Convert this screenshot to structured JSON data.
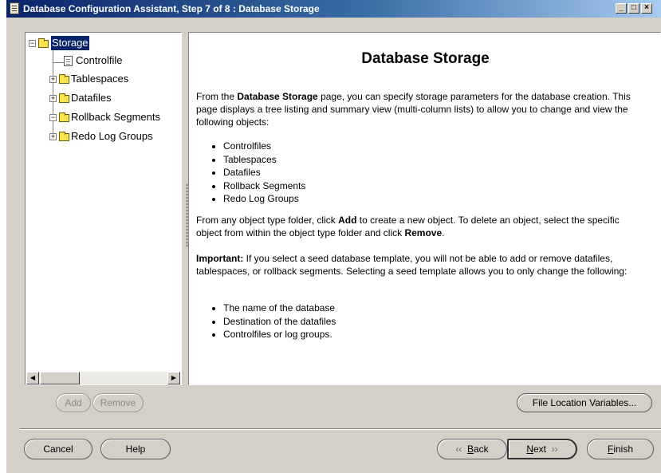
{
  "window": {
    "title": "Database Configuration Assistant, Step 7 of 8 : Database Storage",
    "icon": "app-document-icon",
    "minimize": "_",
    "maximize": "□",
    "close": "×"
  },
  "tree": {
    "items": [
      {
        "label": "Storage",
        "selected": true,
        "icon": "folder-open-icon"
      },
      {
        "label": "Controlfile",
        "icon": "file-icon"
      },
      {
        "label": "Tablespaces",
        "icon": "folder-icon"
      },
      {
        "label": "Datafiles",
        "icon": "folder-icon"
      },
      {
        "label": "Rollback Segments",
        "icon": "folder-open-icon"
      },
      {
        "label": "Redo Log Groups",
        "icon": "folder-icon"
      }
    ]
  },
  "help": {
    "heading": "Database Storage",
    "p1_a": "From the ",
    "p1_b": "Database Storage",
    "p1_c": " page, you can specify storage parameters for the database creation. This page displays a tree listing and summary view (multi-column lists) to allow you to change and view the following objects:",
    "list1": [
      "Controlfiles",
      "Tablespaces",
      "Datafiles",
      "Rollback Segments",
      "Redo Log Groups"
    ],
    "p2_a": "From any object type folder, click ",
    "p2_b": "Add",
    "p2_c": " to create a new object. To delete an object, select the specific object from within the object type folder and click ",
    "p2_d": "Remove",
    "p2_e": ".",
    "p3_a": "Important:",
    "p3_b": " If you select a seed database template, you will not be able to add or remove datafiles, tablespaces, or rollback segments. Selecting a seed template allows you to only change the following:",
    "list2": [
      "The name of the database",
      "Destination of the datafiles",
      "Controlfiles or log groups."
    ]
  },
  "buttons": {
    "add": "Add",
    "remove": "Remove",
    "file_location": "File Location Variables...",
    "cancel": "Cancel",
    "help": "Help",
    "back_mnemonic": "B",
    "back_rest": "ack",
    "next_mnemonic": "N",
    "next_rest": "ext",
    "finish_mnemonic": "F",
    "finish_rest": "inish",
    "back_icon": "chevron-left-icon",
    "next_icon": "chevron-right-icon"
  },
  "colors": {
    "title_bar": "#0a246a",
    "selection": "#0a246a",
    "folder": "#ffe34c",
    "dialog": "#d4d0c8"
  }
}
